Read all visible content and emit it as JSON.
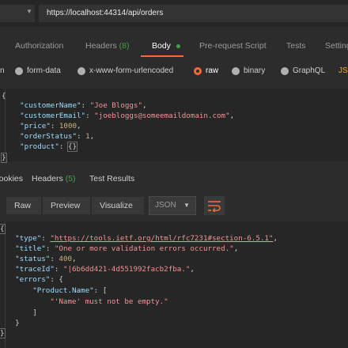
{
  "request": {
    "method_caret": "▼",
    "url": "https://localhost:44314/api/orders"
  },
  "request_tabs": {
    "authorization": "Authorization",
    "headers": "Headers",
    "headers_count": "(8)",
    "body": "Body",
    "prerequest": "Pre-request Script",
    "tests": "Tests",
    "settings": "Settings"
  },
  "body_types": {
    "none": "none",
    "form_data": "form-data",
    "urlencoded": "x-www-form-urlencoded",
    "raw": "raw",
    "binary": "binary",
    "graphql": "GraphQL",
    "format": "JSON",
    "selected": "raw"
  },
  "request_body": {
    "open": "{",
    "close": "}",
    "lines": [
      {
        "key": "\"customerName\"",
        "value": "\"Joe Bloggs\"",
        "type": "str"
      },
      {
        "key": "\"customerEmail\"",
        "value": "\"joebloggs@someemaildomain.com\"",
        "type": "str"
      },
      {
        "key": "\"price\"",
        "value": "1000",
        "type": "num"
      },
      {
        "key": "\"orderStatus\"",
        "value": "1",
        "type": "num"
      },
      {
        "key": "\"product\"",
        "value": "{}",
        "type": "obj"
      }
    ]
  },
  "response_tabs": {
    "cookies": "Cookies",
    "headers": "Headers",
    "headers_count": "(5)",
    "test_results": "Test Results"
  },
  "response_toolbar": {
    "raw": "Raw",
    "preview": "Preview",
    "visualize": "Visualize",
    "format": "JSON",
    "format_caret": "▼",
    "wrap_icon": "wrap-lines-icon"
  },
  "response_body": {
    "open": "{",
    "close": "}",
    "type_key": "\"type\"",
    "type_val": "\"https://tools.ietf.org/html/rfc7231#section-6.5.1\"",
    "title_key": "\"title\"",
    "title_val": "\"One or more validation errors occurred.\"",
    "status_key": "\"status\"",
    "status_val": "400",
    "traceId_key": "\"traceId\"",
    "traceId_val": "\"|6b6dd421-4d551992facb2fba.\"",
    "errors_key": "\"errors\"",
    "product_name_key": "\"Product.Name\"",
    "error_msg": "\"'Name' must not be empty.\""
  },
  "colors": {
    "accent": "#f26b3a",
    "green": "#43a047",
    "json_key": "#9cdcfe",
    "json_string": "#f09494",
    "json_number": "#c8b27c"
  }
}
